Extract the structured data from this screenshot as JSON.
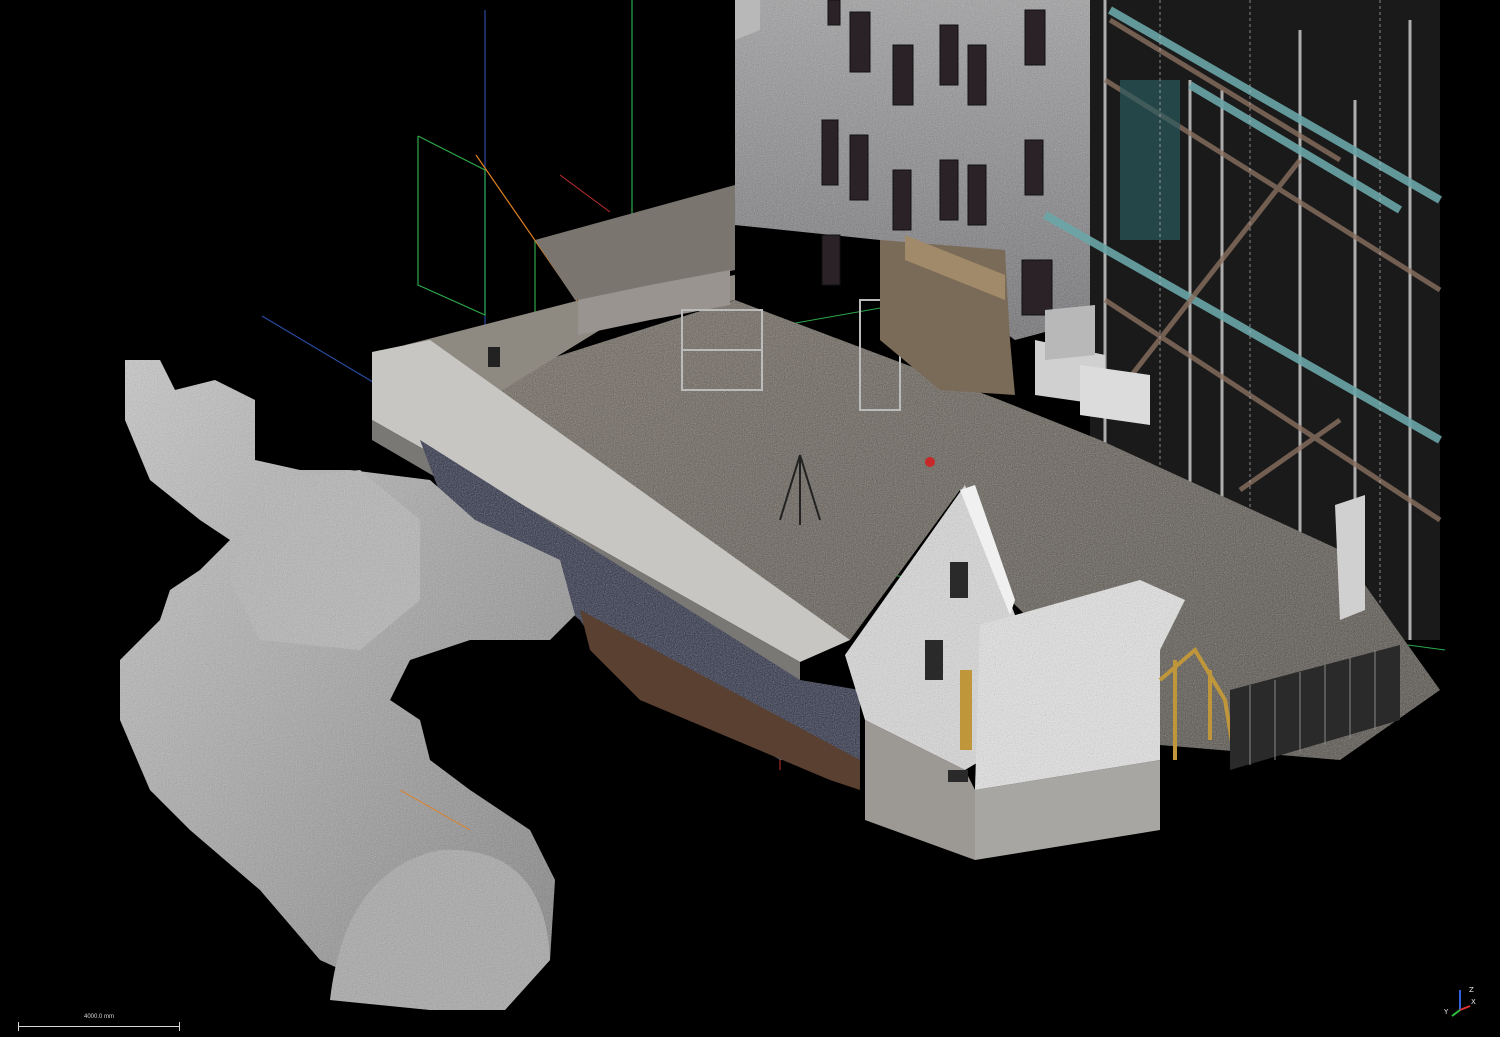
{
  "viewer": {
    "scale_bar_label": "4000.0 mm",
    "axes": {
      "x_label": "X",
      "y_label": "Y",
      "z_label": "Z"
    },
    "colors": {
      "background": "#000000",
      "axis_x": "#e03030",
      "axis_y": "#30c040",
      "axis_z": "#3060e0",
      "guide_orange": "#e08020",
      "guide_green": "#2ea84a",
      "guide_blue": "#2a4aa0"
    }
  }
}
